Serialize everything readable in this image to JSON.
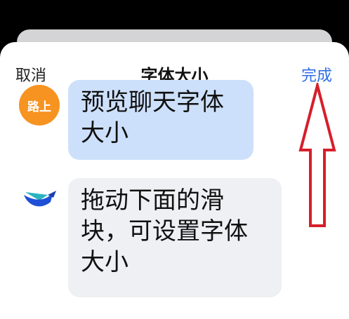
{
  "header": {
    "cancel_label": "取消",
    "title": "字体大小",
    "done_label": "完成"
  },
  "messages": [
    {
      "avatar_text": "路上",
      "text": "预览聊天字体大小"
    },
    {
      "avatar_icon": "bird-logo-icon",
      "text": "拖动下面的滑块，可设置字体大小"
    }
  ],
  "colors": {
    "accent": "#2f6ee6",
    "avatar_orange": "#f79321",
    "bubble_blue": "#cde0fb",
    "bubble_gray": "#eef0f3",
    "annotation_red": "#d61f2b"
  }
}
